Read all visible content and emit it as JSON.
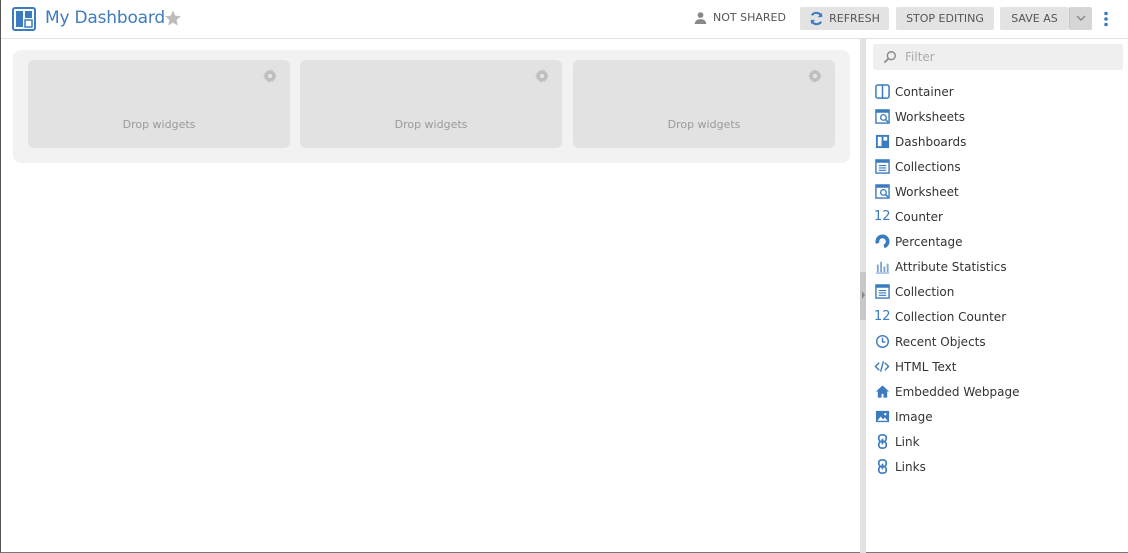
{
  "header": {
    "title": "My Dashboard",
    "share_status": "NOT SHARED",
    "refresh_label": "REFRESH",
    "stop_editing_label": "STOP EDITING",
    "save_as_label": "SAVE AS"
  },
  "canvas": {
    "slots": [
      {
        "label": "Drop widgets"
      },
      {
        "label": "Drop widgets"
      },
      {
        "label": "Drop widgets"
      }
    ]
  },
  "panel": {
    "filter_placeholder": "Filter",
    "widgets": [
      {
        "label": "Container",
        "icon": "container-icon"
      },
      {
        "label": "Worksheets",
        "icon": "worksheets-icon"
      },
      {
        "label": "Dashboards",
        "icon": "dashboards-icon"
      },
      {
        "label": "Collections",
        "icon": "collections-icon"
      },
      {
        "label": "Worksheet",
        "icon": "worksheet-icon"
      },
      {
        "label": "Counter",
        "icon": "counter-icon",
        "glyph": "12"
      },
      {
        "label": "Percentage",
        "icon": "percentage-icon"
      },
      {
        "label": "Attribute Statistics",
        "icon": "bar-chart-icon"
      },
      {
        "label": "Collection",
        "icon": "collection-icon"
      },
      {
        "label": "Collection Counter",
        "icon": "collection-counter-icon",
        "glyph": "12"
      },
      {
        "label": "Recent Objects",
        "icon": "clock-icon"
      },
      {
        "label": "HTML Text",
        "icon": "code-icon"
      },
      {
        "label": "Embedded Webpage",
        "icon": "home-icon"
      },
      {
        "label": "Image",
        "icon": "image-icon"
      },
      {
        "label": "Link",
        "icon": "link-icon"
      },
      {
        "label": "Links",
        "icon": "link-icon"
      }
    ]
  },
  "colors": {
    "accent": "#3b7bbf",
    "title": "#3f7cbf",
    "button_bg": "#e3e3e3",
    "slot_bg": "#e2e2e2",
    "canvas_bg": "#f2f2f2"
  }
}
